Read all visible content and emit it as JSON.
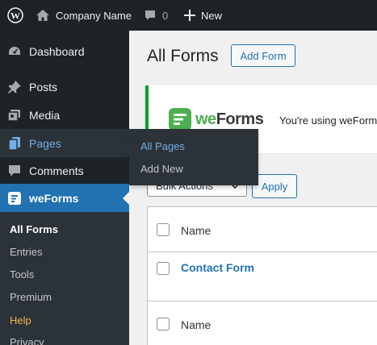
{
  "admin_bar": {
    "site_name": "Company Name",
    "comments_count": "0",
    "new_label": "New"
  },
  "menu": {
    "items": [
      {
        "label": "Dashboard",
        "icon": "dashboard-icon"
      },
      {
        "label": "Posts",
        "icon": "pin-icon"
      },
      {
        "label": "Media",
        "icon": "media-icon"
      },
      {
        "label": "Pages",
        "icon": "pages-icon"
      },
      {
        "label": "Comments",
        "icon": "comment-icon"
      },
      {
        "label": "weForms",
        "icon": "weforms-icon"
      }
    ],
    "submenu": [
      "All Forms",
      "Entries",
      "Tools",
      "Premium",
      "Help",
      "Privacy"
    ]
  },
  "flyout": {
    "items": [
      "All Pages",
      "Add New"
    ]
  },
  "content": {
    "title": "All Forms",
    "add_button": "Add Form",
    "notice_logo_text": "weForms",
    "notice_text": "You're using weForm",
    "bulk_actions": "Bulk Actions",
    "apply": "Apply",
    "column_name": "Name",
    "row_form": "Contact Form",
    "footer_name": "Name"
  },
  "colors": {
    "admin_bg": "#1d2327",
    "accent": "#2271b1",
    "help": "#f0b849",
    "notice_border": "#00a32a"
  }
}
